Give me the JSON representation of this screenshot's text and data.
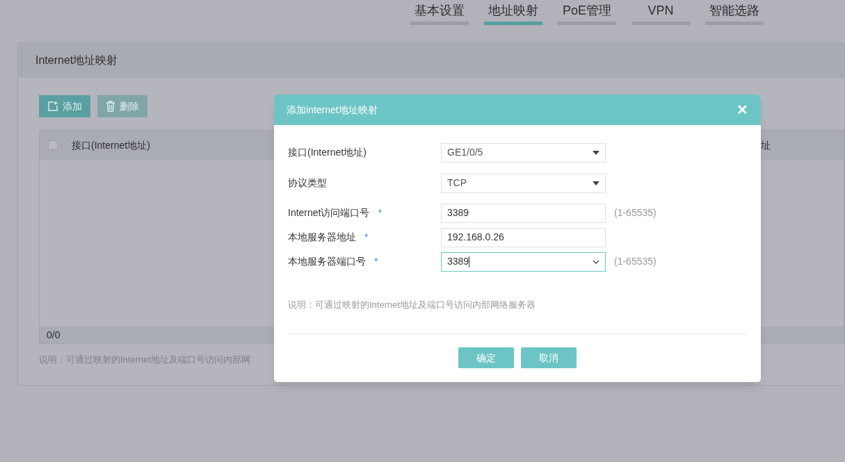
{
  "tabs": [
    {
      "label": "基本设置",
      "selected": false
    },
    {
      "label": "地址映射",
      "selected": true
    },
    {
      "label": "PoE管理",
      "selected": false
    },
    {
      "label": "VPN",
      "selected": false
    },
    {
      "label": "智能选路",
      "selected": false
    }
  ],
  "panel": {
    "title": "Internet地址映射",
    "buttons": [
      {
        "label": "添加",
        "disabled": false,
        "kind": "add"
      },
      {
        "label": "删除",
        "disabled": true,
        "kind": "delete"
      }
    ],
    "table": {
      "select_all_checked": false,
      "columns": [
        "接口(Internet地址)",
        "址"
      ],
      "footer": "0/0"
    },
    "note": "说明：可通过映射的Internet地址及端口号访问内部网"
  },
  "dialog": {
    "title": "添加internet地址映射",
    "close": "✕",
    "fields": [
      {
        "label": "接口(Internet地址)",
        "kind": "select",
        "value": "GE1/0/5",
        "focused": false
      },
      {
        "label": "协议类型",
        "kind": "select",
        "value": "TCP",
        "focused": false
      },
      {
        "label": "Internet访问端口号",
        "kind": "input",
        "value": "3389",
        "required_mark": "*",
        "focused": false,
        "hint": "(1-65535)"
      },
      {
        "label": "本地服务器地址",
        "kind": "input",
        "value": "192.168.0.26",
        "required_mark": "*",
        "focused": false
      },
      {
        "label": "本地服务器端口号",
        "kind": "combo",
        "value": "3389",
        "required_mark": "*",
        "focused": true,
        "hint": "(1-65535)"
      }
    ],
    "note": "说明：可通过映射的Internet地址及端口号访问内部网络服务器",
    "buttons": [
      "确定",
      "取消"
    ]
  }
}
